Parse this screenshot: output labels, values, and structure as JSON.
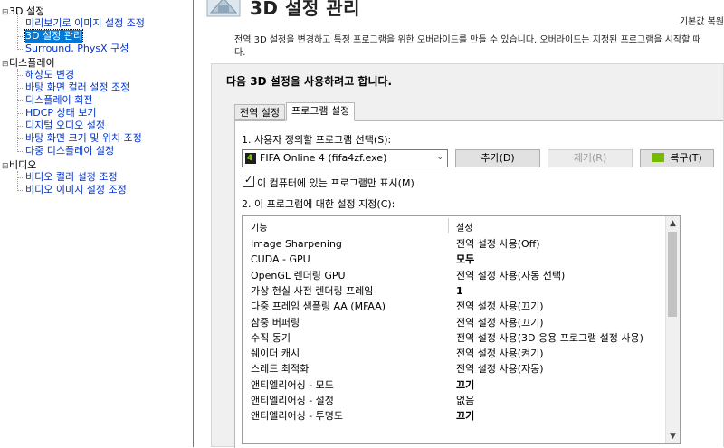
{
  "sidebar": {
    "categories": [
      {
        "label": "3D 설정",
        "expander": "⊟"
      },
      {
        "label": "디스플레이",
        "expander": "⊟"
      },
      {
        "label": "비디오",
        "expander": "⊟"
      }
    ],
    "items_3d": [
      {
        "label": "미리보기로 이미지 설정 조정"
      },
      {
        "label": "3D 설정 관리",
        "selected": true
      },
      {
        "label": "Surround, PhysX 구성"
      }
    ],
    "items_display": [
      {
        "label": "해상도 변경"
      },
      {
        "label": "바탕 화면 컬러 설정 조정"
      },
      {
        "label": "디스플레이 회전"
      },
      {
        "label": "HDCP 상태 보기"
      },
      {
        "label": "디지털 오디오 설정"
      },
      {
        "label": "바탕 화면 크기 및 위치 조정"
      },
      {
        "label": "다중 디스플레이 설정"
      }
    ],
    "items_video": [
      {
        "label": "비디오 컬러 설정 조정"
      },
      {
        "label": "비디오 이미지 설정 조정"
      }
    ]
  },
  "header": {
    "title": "3D 설정 관리",
    "restore_link": "기본값 복원",
    "description": "전역 3D 설정을 변경하고 특정 프로그램을 위한 오버라이드를 만들 수 있습니다. 오버라이드는 지정된 프로그램을 시작할 때",
    "description_line2": "다."
  },
  "panel": {
    "heading": "다음 3D 설정을 사용하려고 합니다.",
    "tabs": [
      {
        "label": "전역 설정",
        "active": false
      },
      {
        "label": "프로그램 설정",
        "active": true
      }
    ],
    "step1_label": "1. 사용자 정의할 프로그램 선택(S):",
    "program_select_value": "FIFA Online 4 (fifa4zf.exe)",
    "app_icon_glyph": "4",
    "add_button": "추가(D)",
    "remove_button": "제거(R)",
    "restore_button": "복구(T)",
    "checkbox_checked": true,
    "checkbox_label": "이 컴퓨터에 있는 프로그램만 표시(M)",
    "step2_label": "2. 이 프로그램에 대한 설정 지정(C):",
    "col_feature": "기능",
    "col_setting": "설정",
    "settings": [
      {
        "feature": "Image Sharpening",
        "value": "전역 설정 사용(Off)",
        "bold": false
      },
      {
        "feature": "CUDA - GPU",
        "value": "모두",
        "bold": true
      },
      {
        "feature": "OpenGL 렌더링 GPU",
        "value": "전역 설정 사용(자동 선택)",
        "bold": false
      },
      {
        "feature": "가상 현실 사전 렌더링 프레임",
        "value": "1",
        "bold": true
      },
      {
        "feature": "다중 프레임 샘플링 AA (MFAA)",
        "value": "전역 설정 사용(끄기)",
        "bold": false
      },
      {
        "feature": "삼중 버퍼링",
        "value": "전역 설정 사용(끄기)",
        "bold": false
      },
      {
        "feature": "수직 동기",
        "value": "전역 설정 사용(3D 응용 프로그램 설정 사용)",
        "bold": false
      },
      {
        "feature": "쉐이더 캐시",
        "value": "전역 설정 사용(켜기)",
        "bold": false
      },
      {
        "feature": "스레드 최적화",
        "value": "전역 설정 사용(자동)",
        "bold": false
      },
      {
        "feature": "앤티엘리어싱 - 모드",
        "value": "끄기",
        "bold": true
      },
      {
        "feature": "앤티엘리어싱 - 설정",
        "value": "없음",
        "bold": false
      },
      {
        "feature": "앤티엘리어싱 - 투명도",
        "value": "끄기",
        "bold": true
      }
    ]
  },
  "colors": {
    "link": "#0033cc",
    "selection": "#0078d7",
    "nvidia_green": "#76b900"
  }
}
